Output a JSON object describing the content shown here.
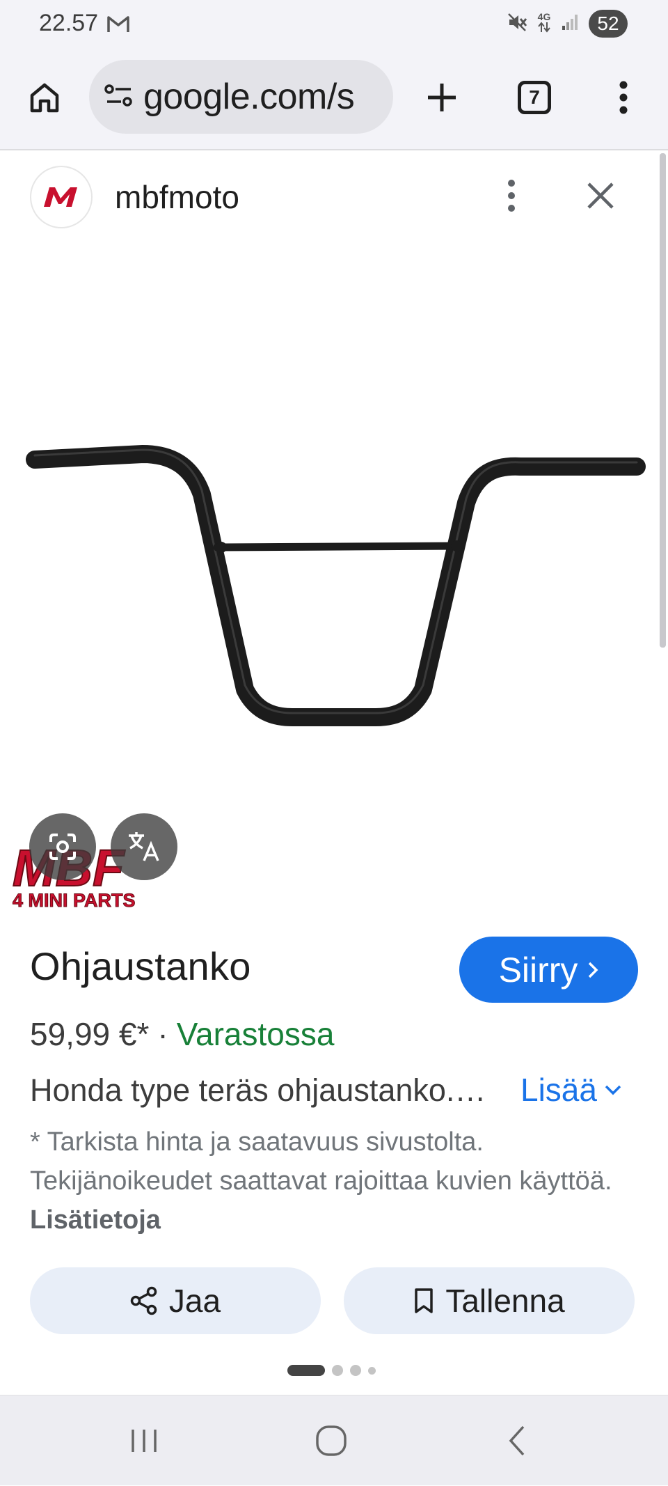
{
  "status_bar": {
    "time": "22.57",
    "network": "4G",
    "battery": "52",
    "icons": [
      "gmail-icon",
      "mute-icon",
      "data-arrows-icon",
      "signal-icon"
    ]
  },
  "browser": {
    "url": "google.com/s",
    "tab_count": "7",
    "icons": [
      "home-icon",
      "site-settings-icon",
      "new-tab-icon",
      "menu-icon"
    ]
  },
  "sheet": {
    "site_name": "mbfmoto",
    "site_logo_letter": "M",
    "icons": [
      "more-vert-icon",
      "close-icon"
    ]
  },
  "image": {
    "watermark_main": "MBF",
    "watermark_sub": "4 MINI PARTS",
    "overlay_buttons": [
      "google-lens-icon",
      "translate-icon"
    ]
  },
  "product": {
    "title": "Ohjaustanko",
    "visit_label": "Siirry",
    "price": "59,99 €*",
    "separator": "·",
    "stock": "Varastossa",
    "description": "Honda type teräs ohjaustanko.…",
    "more_label": "Lisää",
    "disclaimer": "* Tarkista hinta ja saatavuus sivustolta. Tekijänoikeudet saattavat rajoittaa kuvien käyttöä.",
    "disclaimer_link": "Lisätietoja"
  },
  "actions": {
    "share_label": "Jaa",
    "save_label": "Tallenna"
  },
  "pager": {
    "count": 4,
    "active": 0
  },
  "colors": {
    "accent": "#1a73e8",
    "stock_green": "#188038",
    "action_bg": "#e8eef8",
    "logo_red": "#c8102e"
  }
}
